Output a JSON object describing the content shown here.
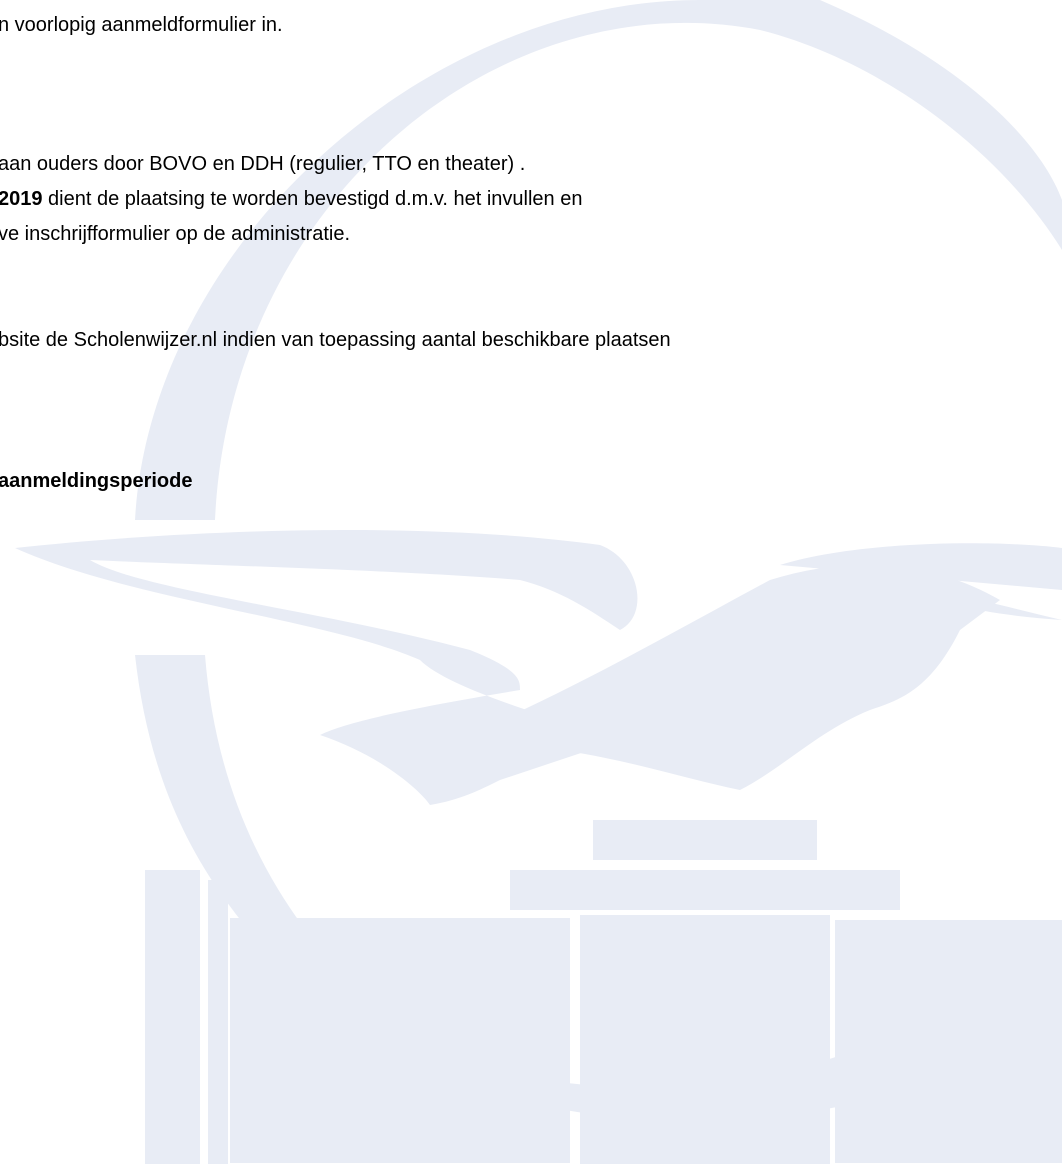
{
  "document": {
    "lines": [
      {
        "text": "n voorlopig aanmeldformulier in."
      },
      {
        "text": " aan ouders door BOVO en DDH (regulier, TTO en theater) ."
      },
      {
        "bold": " 2019",
        "text": " dient de plaatsing te worden bevestigd d.m.v. het invullen en"
      },
      {
        "text": "ve inschrijfformulier op de administratie."
      },
      {
        "text": "bsite de Scholenwijzer.nl indien van toepassing aantal beschikbare plaatsen"
      },
      {
        "text": "aanmeldingsperiode"
      }
    ]
  },
  "watermark": {
    "type": "school-logo-seagull-and-building",
    "color": "#e8ecf5"
  }
}
